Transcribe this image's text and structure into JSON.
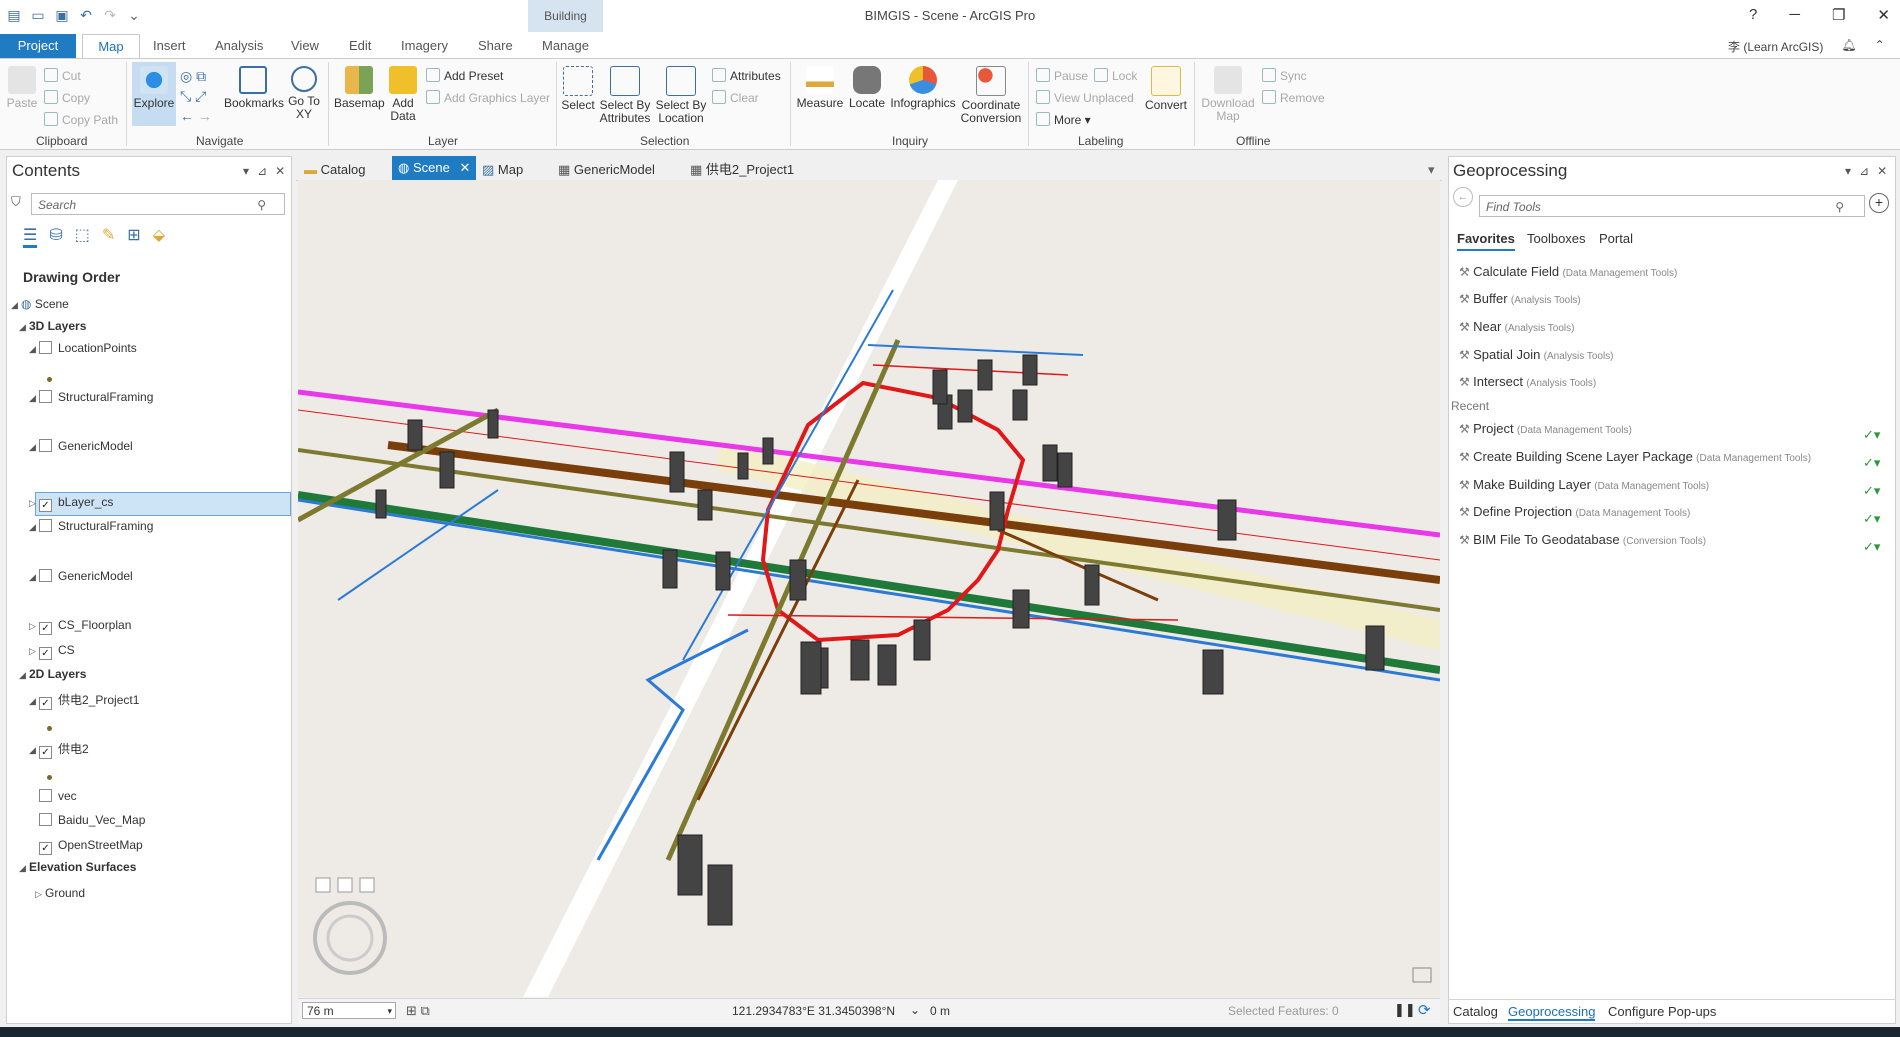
{
  "app": {
    "title": "BIMGIS - Scene - ArcGIS Pro",
    "context_group": "Building",
    "user": "李 (Learn ArcGIS)",
    "help": "?",
    "min": "─",
    "restore": "❐",
    "close": "✕"
  },
  "ribbon_tabs": [
    "Project",
    "Map",
    "Insert",
    "Analysis",
    "View",
    "Edit",
    "Imagery",
    "Share",
    "Manage"
  ],
  "ribbon": {
    "clipboard": {
      "paste": "Paste",
      "cut": "Cut",
      "copy": "Copy",
      "copy_path": "Copy Path",
      "label": "Clipboard"
    },
    "navigate": {
      "explore": "Explore",
      "bookmarks": "Bookmarks",
      "go_to_xy": "Go To XY",
      "label": "Navigate"
    },
    "layer": {
      "basemap": "Basemap",
      "add_data": "Add Data",
      "add_preset": "Add Preset",
      "add_graphics": "Add Graphics Layer",
      "label": "Layer"
    },
    "selection": {
      "select": "Select",
      "by_attributes": "Select By Attributes",
      "by_location": "Select By Location",
      "attributes": "Attributes",
      "clear": "Clear",
      "label": "Selection"
    },
    "inquiry": {
      "measure": "Measure",
      "locate": "Locate",
      "infographics": "Infographics",
      "coord_conv": "Coordinate Conversion",
      "label": "Inquiry"
    },
    "labeling": {
      "pause": "Pause",
      "lock": "Lock",
      "view_unplaced": "View Unplaced",
      "more": "More",
      "convert": "Convert",
      "label": "Labeling"
    },
    "offline": {
      "download_map": "Download Map",
      "sync": "Sync",
      "remove": "Remove",
      "label": "Offline"
    }
  },
  "contents": {
    "title": "Contents",
    "search_placeholder": "Search",
    "drawing_order": "Drawing Order",
    "items": [
      {
        "label": "Scene",
        "type": "root"
      },
      {
        "label": "3D Layers",
        "type": "group"
      },
      {
        "label": "LocationPoints",
        "checked": false
      },
      {
        "label": "StructuralFraming",
        "checked": false
      },
      {
        "label": "GenericModel",
        "checked": false
      },
      {
        "label": "bLayer_cs",
        "checked": true,
        "selected": true
      },
      {
        "label": "StructuralFraming",
        "checked": false
      },
      {
        "label": "GenericModel",
        "checked": false
      },
      {
        "label": "CS_Floorplan",
        "checked": true
      },
      {
        "label": "CS",
        "checked": true
      },
      {
        "label": "2D Layers",
        "type": "group"
      },
      {
        "label": "供电2_Project1",
        "checked": true
      },
      {
        "label": "供电2",
        "checked": true
      },
      {
        "label": "vec",
        "checked": false
      },
      {
        "label": "Baidu_Vec_Map",
        "checked": false
      },
      {
        "label": "OpenStreetMap",
        "checked": true
      },
      {
        "label": "Elevation Surfaces",
        "type": "group"
      },
      {
        "label": "Ground",
        "type": "leaf"
      }
    ]
  },
  "view_tabs": [
    {
      "label": "Catalog"
    },
    {
      "label": "Scene",
      "active": true
    },
    {
      "label": "Map"
    },
    {
      "label": "GenericModel"
    },
    {
      "label": "供电2_Project1"
    }
  ],
  "status": {
    "scale": "76 m",
    "coords": "121.2934783°E 31.3450398°N",
    "elevation": "0 m",
    "selected": "Selected Features: 0"
  },
  "geoprocessing": {
    "title": "Geoprocessing",
    "search_placeholder": "Find Tools",
    "tabs": [
      "Favorites",
      "Toolboxes",
      "Portal"
    ],
    "favorites": [
      {
        "name": "Calculate Field",
        "toolbox": "(Data Management Tools)"
      },
      {
        "name": "Buffer",
        "toolbox": "(Analysis Tools)"
      },
      {
        "name": "Near",
        "toolbox": "(Analysis Tools)"
      },
      {
        "name": "Spatial Join",
        "toolbox": "(Analysis Tools)"
      },
      {
        "name": "Intersect",
        "toolbox": "(Analysis Tools)"
      }
    ],
    "recent_label": "Recent",
    "recent": [
      {
        "name": "Project",
        "toolbox": "(Data Management Tools)"
      },
      {
        "name": "Create Building Scene Layer Package",
        "toolbox": "(Data Management Tools)"
      },
      {
        "name": "Make Building Layer",
        "toolbox": "(Data Management Tools)"
      },
      {
        "name": "Define Projection",
        "toolbox": "(Data Management Tools)"
      },
      {
        "name": "BIM File To Geodatabase",
        "toolbox": "(Conversion Tools)"
      }
    ],
    "bottom_tabs": [
      "Catalog",
      "Geoprocessing",
      "Configure Pop-ups"
    ]
  },
  "colors": {
    "accent": "#1f7bc2",
    "magenta": "#e838e8",
    "brown": "#7a3e0a",
    "green": "#1f7a3a",
    "red": "#e01818",
    "blue": "#2b7ad6",
    "olive": "#7d7a30"
  }
}
